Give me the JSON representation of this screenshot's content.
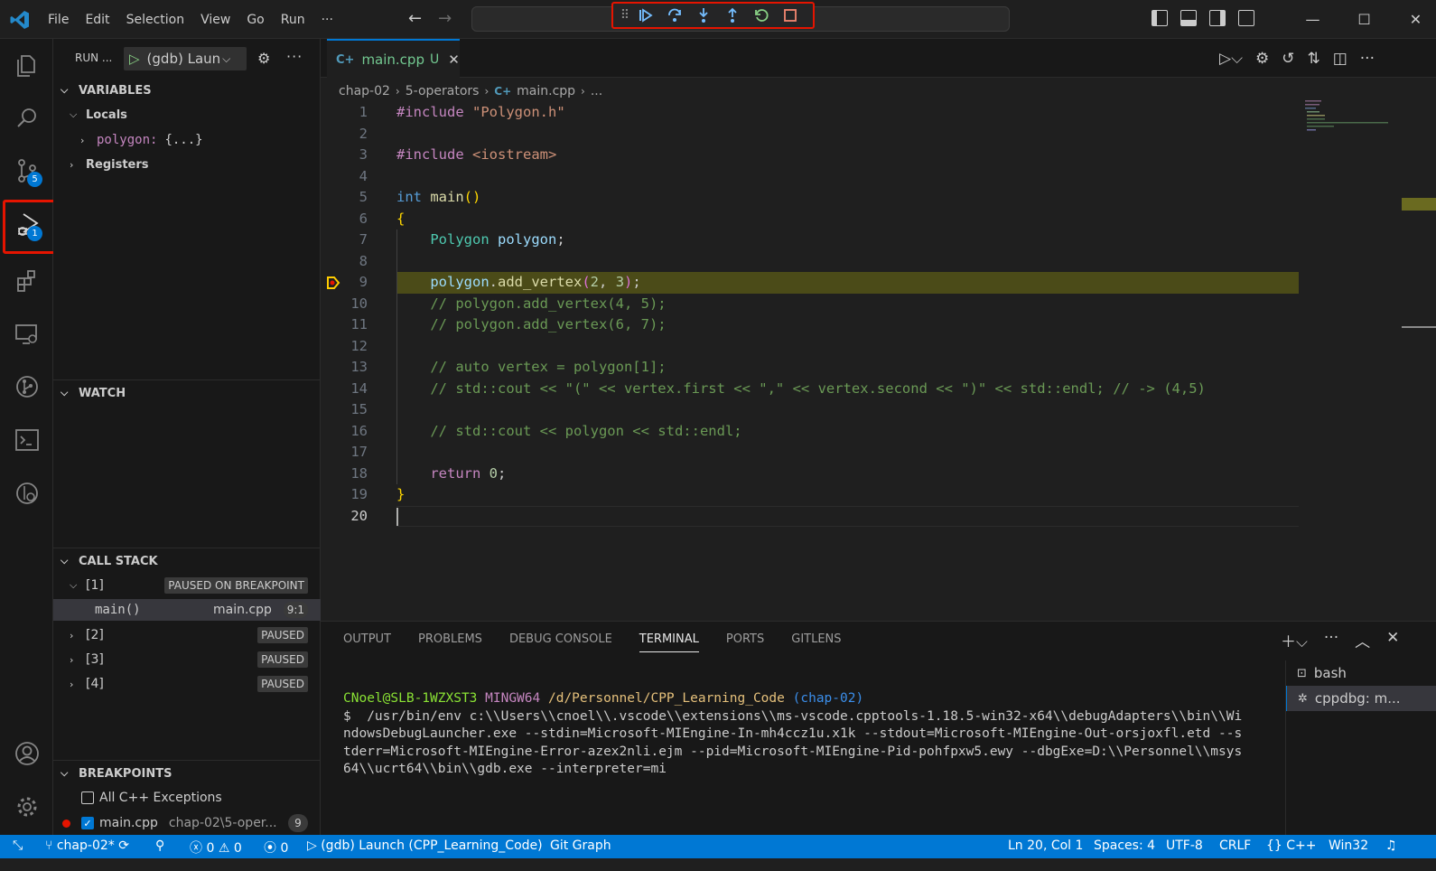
{
  "menu": [
    "File",
    "Edit",
    "Selection",
    "View",
    "Go",
    "Run",
    "···"
  ],
  "debug_toolbar": [
    "drag-handle",
    "continue",
    "step-over",
    "step-into",
    "step-out",
    "restart",
    "stop"
  ],
  "window_controls": [
    "—",
    "☐",
    "✕"
  ],
  "activity": {
    "source_control_badge": "5",
    "run_debug_badge": "1"
  },
  "sidebar": {
    "title": "RUN ...",
    "launch_config": "(gdb) Laun",
    "variables": {
      "header": "VARIABLES",
      "locals_label": "Locals",
      "polygon_name": "polygon:",
      "polygon_value": "{...}",
      "registers_label": "Registers"
    },
    "watch": {
      "header": "WATCH"
    },
    "call_stack": {
      "header": "CALL STACK",
      "threads": [
        {
          "label": "[1]",
          "status": "PAUSED ON BREAKPOINT"
        },
        {
          "label": "[2]",
          "status": "PAUSED"
        },
        {
          "label": "[3]",
          "status": "PAUSED"
        },
        {
          "label": "[4]",
          "status": "PAUSED"
        }
      ],
      "frame": {
        "func": "main()",
        "file": "main.cpp",
        "pos": "9:1"
      }
    },
    "breakpoints": {
      "header": "BREAKPOINTS",
      "all_exceptions": "All C++ Exceptions",
      "bp_file": "main.cpp",
      "bp_path": "chap-02\\5-oper...",
      "bp_line": "9"
    }
  },
  "editor": {
    "tab_name": "main.cpp",
    "tab_status": "U",
    "breadcrumb": [
      "chap-02",
      "5-operators",
      "main.cpp",
      "..."
    ],
    "current_line": "20",
    "paused_line": "9",
    "lines": [
      "#include \"Polygon.h\"",
      "",
      "#include <iostream>",
      "",
      "int main()",
      "{",
      "    Polygon polygon;",
      "",
      "    polygon.add_vertex(2, 3);",
      "    // polygon.add_vertex(4, 5);",
      "    // polygon.add_vertex(6, 7);",
      "",
      "    // auto vertex = polygon[1];",
      "    // std::cout << \"(\" << vertex.first << \",\" << vertex.second << \")\" << std::endl; // -> (4,5)",
      "",
      "    // std::cout << polygon << std::endl;",
      "",
      "    return 0;",
      "}",
      ""
    ]
  },
  "panel": {
    "tabs": [
      "OUTPUT",
      "PROBLEMS",
      "DEBUG CONSOLE",
      "TERMINAL",
      "PORTS",
      "GITLENS"
    ],
    "active_tab": "TERMINAL",
    "terminal": {
      "prompt_user": "CNoel@SLB-1WZXST3",
      "prompt_env": "MINGW64",
      "prompt_path": "/d/Personnel/CPP_Learning_Code",
      "prompt_branch": "(chap-02)",
      "command_lines": [
        "$  /usr/bin/env c:\\\\Users\\\\cnoel\\\\.vscode\\\\extensions\\\\ms-vscode.cpptools-1.18.5-win32-x64\\\\debugAdapters\\\\bin\\\\Wi",
        "ndowsDebugLauncher.exe --stdin=Microsoft-MIEngine-In-mh4ccz1u.x1k --stdout=Microsoft-MIEngine-Out-orsjoxfl.etd --s",
        "tderr=Microsoft-MIEngine-Error-azex2nli.ejm --pid=Microsoft-MIEngine-Pid-pohfpxw5.ewy --dbgExe=D:\\\\Personnel\\\\msys",
        "64\\\\ucrt64\\\\bin\\\\gdb.exe --interpreter=mi"
      ]
    },
    "terminal_list": [
      "bash",
      "cppdbg: m..."
    ]
  },
  "statusbar": {
    "remote": "⤡",
    "branch": "chap-02*",
    "errors": "0",
    "warnings": "0",
    "ports": "0",
    "debug_config": "(gdb) Launch (CPP_Learning_Code)",
    "git_graph": "Git Graph",
    "position": "Ln 20, Col 1",
    "spaces": "Spaces: 4",
    "encoding": "UTF-8",
    "eol": "CRLF",
    "language": "C++",
    "platform": "Win32"
  },
  "colors": {
    "accent": "#0078d4",
    "highlight": "#e51400",
    "paused_line": "#4b4b18"
  }
}
